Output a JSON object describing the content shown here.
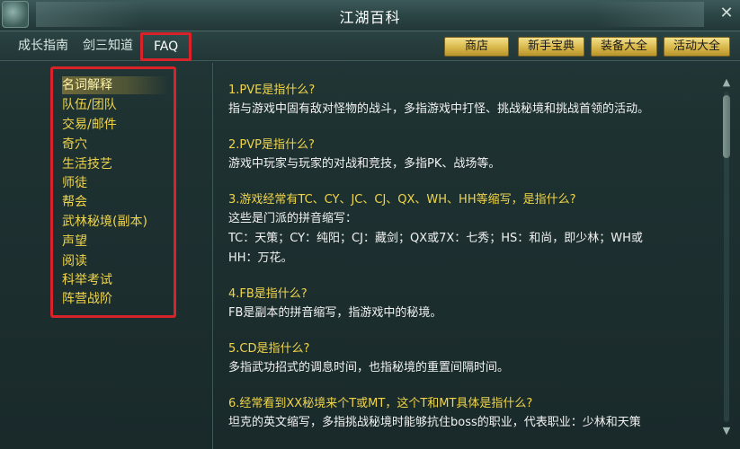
{
  "window": {
    "title": "江湖百科"
  },
  "nav": {
    "tabs": [
      {
        "label": "成长指南"
      },
      {
        "label": "剑三知道"
      },
      {
        "label": "FAQ"
      }
    ],
    "buttons": [
      {
        "label": "商店"
      },
      {
        "label": "新手宝典"
      },
      {
        "label": "装备大全"
      },
      {
        "label": "活动大全"
      }
    ]
  },
  "categories": [
    {
      "label": "名词解释"
    },
    {
      "label": "队伍/团队"
    },
    {
      "label": "交易/邮件"
    },
    {
      "label": "奇穴"
    },
    {
      "label": "生活技艺"
    },
    {
      "label": "师徒"
    },
    {
      "label": "帮会"
    },
    {
      "label": "武林秘境(副本)"
    },
    {
      "label": "声望"
    },
    {
      "label": "阅读"
    },
    {
      "label": "科举考试"
    },
    {
      "label": "阵营战阶"
    }
  ],
  "faqs": [
    {
      "q": "1.PVE是指什么?",
      "a": [
        "指与游戏中固有敌对怪物的战斗，多指游戏中打怪、挑战秘境和挑战首领的活动。"
      ]
    },
    {
      "q": "2.PVP是指什么?",
      "a": [
        "游戏中玩家与玩家的对战和竞技，多指PK、战场等。"
      ]
    },
    {
      "q": "3.游戏经常有TC、CY、JC、CJ、QX、WH、HH等缩写，是指什么?",
      "a": [
        "这些是门派的拼音缩写：",
        "TC：天策；CY：纯阳；CJ：藏剑；QX或7X：七秀；HS：和尚，即少林；WH或",
        "HH：万花。"
      ]
    },
    {
      "q": "4.FB是指什么?",
      "a": [
        "FB是副本的拼音缩写，指游戏中的秘境。"
      ]
    },
    {
      "q": "5.CD是指什么?",
      "a": [
        "多指武功招式的调息时间，也指秘境的重置间隔时间。"
      ]
    },
    {
      "q": "6.经常看到XX秘境来个T或MT，这个T和MT具体是指什么?",
      "a": [
        "坦克的英文缩写，多指挑战秘境时能够抗住boss的职业，代表职业：少林和天策"
      ]
    }
  ],
  "colors": {
    "highlight_border": "#d8232a",
    "question_text": "#f0d54a",
    "category_text": "#f0d54a",
    "gold_button": "#e3c55a"
  }
}
